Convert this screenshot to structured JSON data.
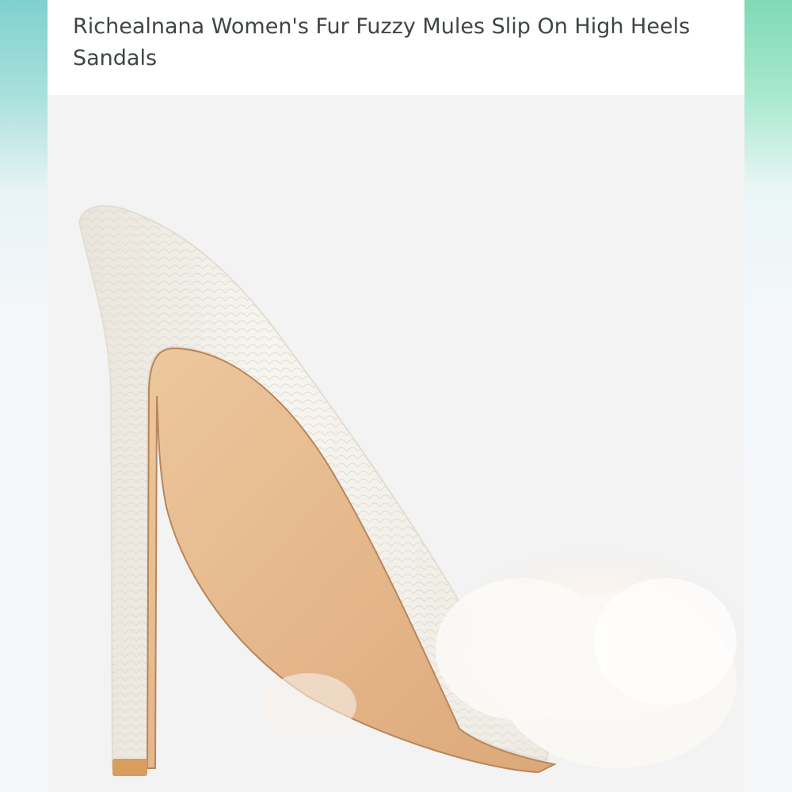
{
  "product": {
    "title": "Richealnana Women's Fur Fuzzy Mules Slip On High Heels Sandals"
  },
  "colors": {
    "background": "#f3f3f3",
    "title_text": "#3f4547",
    "shoe_upper": "#f4f1eb",
    "insole": "#e4b98c",
    "heel_tip": "#d99e5e",
    "fur": "#faf6f2"
  }
}
